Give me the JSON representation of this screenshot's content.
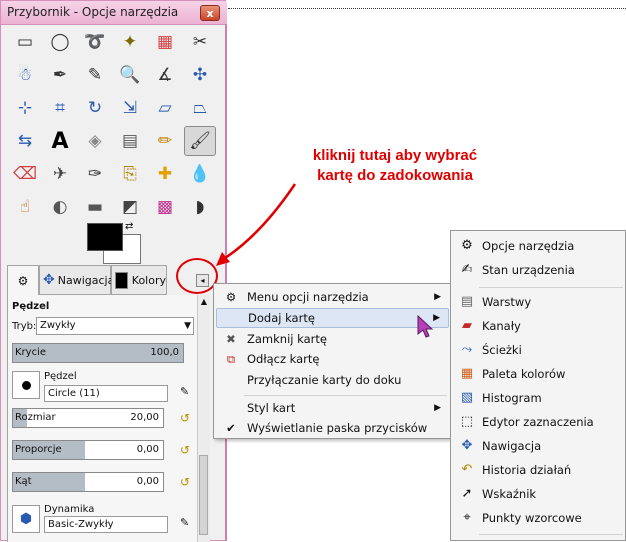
{
  "window": {
    "title": "Przybornik - Opcje narzędzia",
    "close_label": "x"
  },
  "tools": [
    {
      "icon": "rect-select-icon",
      "glyph": "▭"
    },
    {
      "icon": "ellipse-select-icon",
      "glyph": "◯"
    },
    {
      "icon": "free-select-icon",
      "glyph": "➰"
    },
    {
      "icon": "fuzzy-select-icon",
      "glyph": "✦"
    },
    {
      "icon": "color-select-icon",
      "glyph": "▦"
    },
    {
      "icon": "scissors-select-icon",
      "glyph": "✂"
    },
    {
      "icon": "foreground-select-icon",
      "glyph": "☃"
    },
    {
      "icon": "paths-icon",
      "glyph": "✒"
    },
    {
      "icon": "color-picker-icon",
      "glyph": "✎"
    },
    {
      "icon": "zoom-icon",
      "glyph": "🔍"
    },
    {
      "icon": "measure-icon",
      "glyph": "∡"
    },
    {
      "icon": "move-icon",
      "glyph": "✣"
    },
    {
      "icon": "align-icon",
      "glyph": "⊹"
    },
    {
      "icon": "crop-icon",
      "glyph": "⌗"
    },
    {
      "icon": "rotate-icon",
      "glyph": "↻"
    },
    {
      "icon": "scale-icon",
      "glyph": "⇲"
    },
    {
      "icon": "shear-icon",
      "glyph": "▱"
    },
    {
      "icon": "perspective-icon",
      "glyph": "⏢"
    },
    {
      "icon": "flip-icon",
      "glyph": "⇆"
    },
    {
      "icon": "text-icon",
      "glyph": "A"
    },
    {
      "icon": "bucket-fill-icon",
      "glyph": "◈"
    },
    {
      "icon": "blend-icon",
      "glyph": "▤"
    },
    {
      "icon": "pencil-icon",
      "glyph": "✏"
    },
    {
      "icon": "paintbrush-icon",
      "glyph": "🖌"
    },
    {
      "icon": "eraser-icon",
      "glyph": "⌫"
    },
    {
      "icon": "airbrush-icon",
      "glyph": "✈"
    },
    {
      "icon": "ink-icon",
      "glyph": "✑"
    },
    {
      "icon": "clone-icon",
      "glyph": "⎘"
    },
    {
      "icon": "heal-icon",
      "glyph": "✚"
    },
    {
      "icon": "blur-icon",
      "glyph": "💧"
    },
    {
      "icon": "smudge-icon",
      "glyph": "☝"
    },
    {
      "icon": "dodge-burn-icon",
      "glyph": "◐"
    },
    {
      "icon": "eraser2-icon",
      "glyph": "▬"
    },
    {
      "icon": "levels-icon",
      "glyph": "◩"
    },
    {
      "icon": "colors-icon",
      "glyph": "▩"
    },
    {
      "icon": "curves-icon",
      "glyph": "◗"
    }
  ],
  "tabs": {
    "navigation": "Nawigacja",
    "colors": "Kolory"
  },
  "options": {
    "tool_name": "Pędzel",
    "mode_label": "Tryb:",
    "mode_value": "Zwykły",
    "opacity_label": "Krycie",
    "opacity_value": "100,0",
    "brush_label": "Pędzel",
    "brush_value": "Circle (11)",
    "size_label": "Rozmiar",
    "size_value": "20,00",
    "aspect_label": "Proporcje",
    "aspect_value": "0,00",
    "angle_label": "Kąt",
    "angle_value": "0,00",
    "dynamics_label": "Dynamika",
    "dynamics_value": "Basic-Zwykły"
  },
  "annotation": {
    "line1": "kliknij tutaj aby wybrać",
    "line2": "kartę do zadokowania"
  },
  "menu1": {
    "items": [
      {
        "label": "Menu opcji narzędzia",
        "submenu": true
      },
      {
        "label": "Dodaj kartę",
        "submenu": true,
        "highlighted": true
      },
      {
        "label": "Zamknij kartę"
      },
      {
        "label": "Odłącz kartę"
      },
      {
        "label": "Przyłączanie karty do doku"
      },
      {
        "label": "Styl kart",
        "submenu": true
      },
      {
        "label": "Wyświetlanie paska przycisków",
        "checked": true
      }
    ]
  },
  "menu2": {
    "items": [
      {
        "label": "Opcje narzędzia",
        "icon": "tool-options-icon"
      },
      {
        "label": "Stan urządzenia",
        "icon": "device-status-icon"
      },
      {
        "label": "Warstwy",
        "icon": "layers-icon"
      },
      {
        "label": "Kanały",
        "icon": "channels-icon"
      },
      {
        "label": "Ścieżki",
        "icon": "paths-icon"
      },
      {
        "label": "Paleta kolorów",
        "icon": "palette-icon"
      },
      {
        "label": "Histogram",
        "icon": "histogram-icon"
      },
      {
        "label": "Edytor zaznaczenia",
        "icon": "selection-editor-icon"
      },
      {
        "label": "Nawigacja",
        "icon": "navigation-icon"
      },
      {
        "label": "Historia działań",
        "icon": "undo-history-icon"
      },
      {
        "label": "Wskaźnik",
        "icon": "pointer-icon"
      },
      {
        "label": "Punkty wzorcowe",
        "icon": "sample-points-icon"
      }
    ]
  }
}
